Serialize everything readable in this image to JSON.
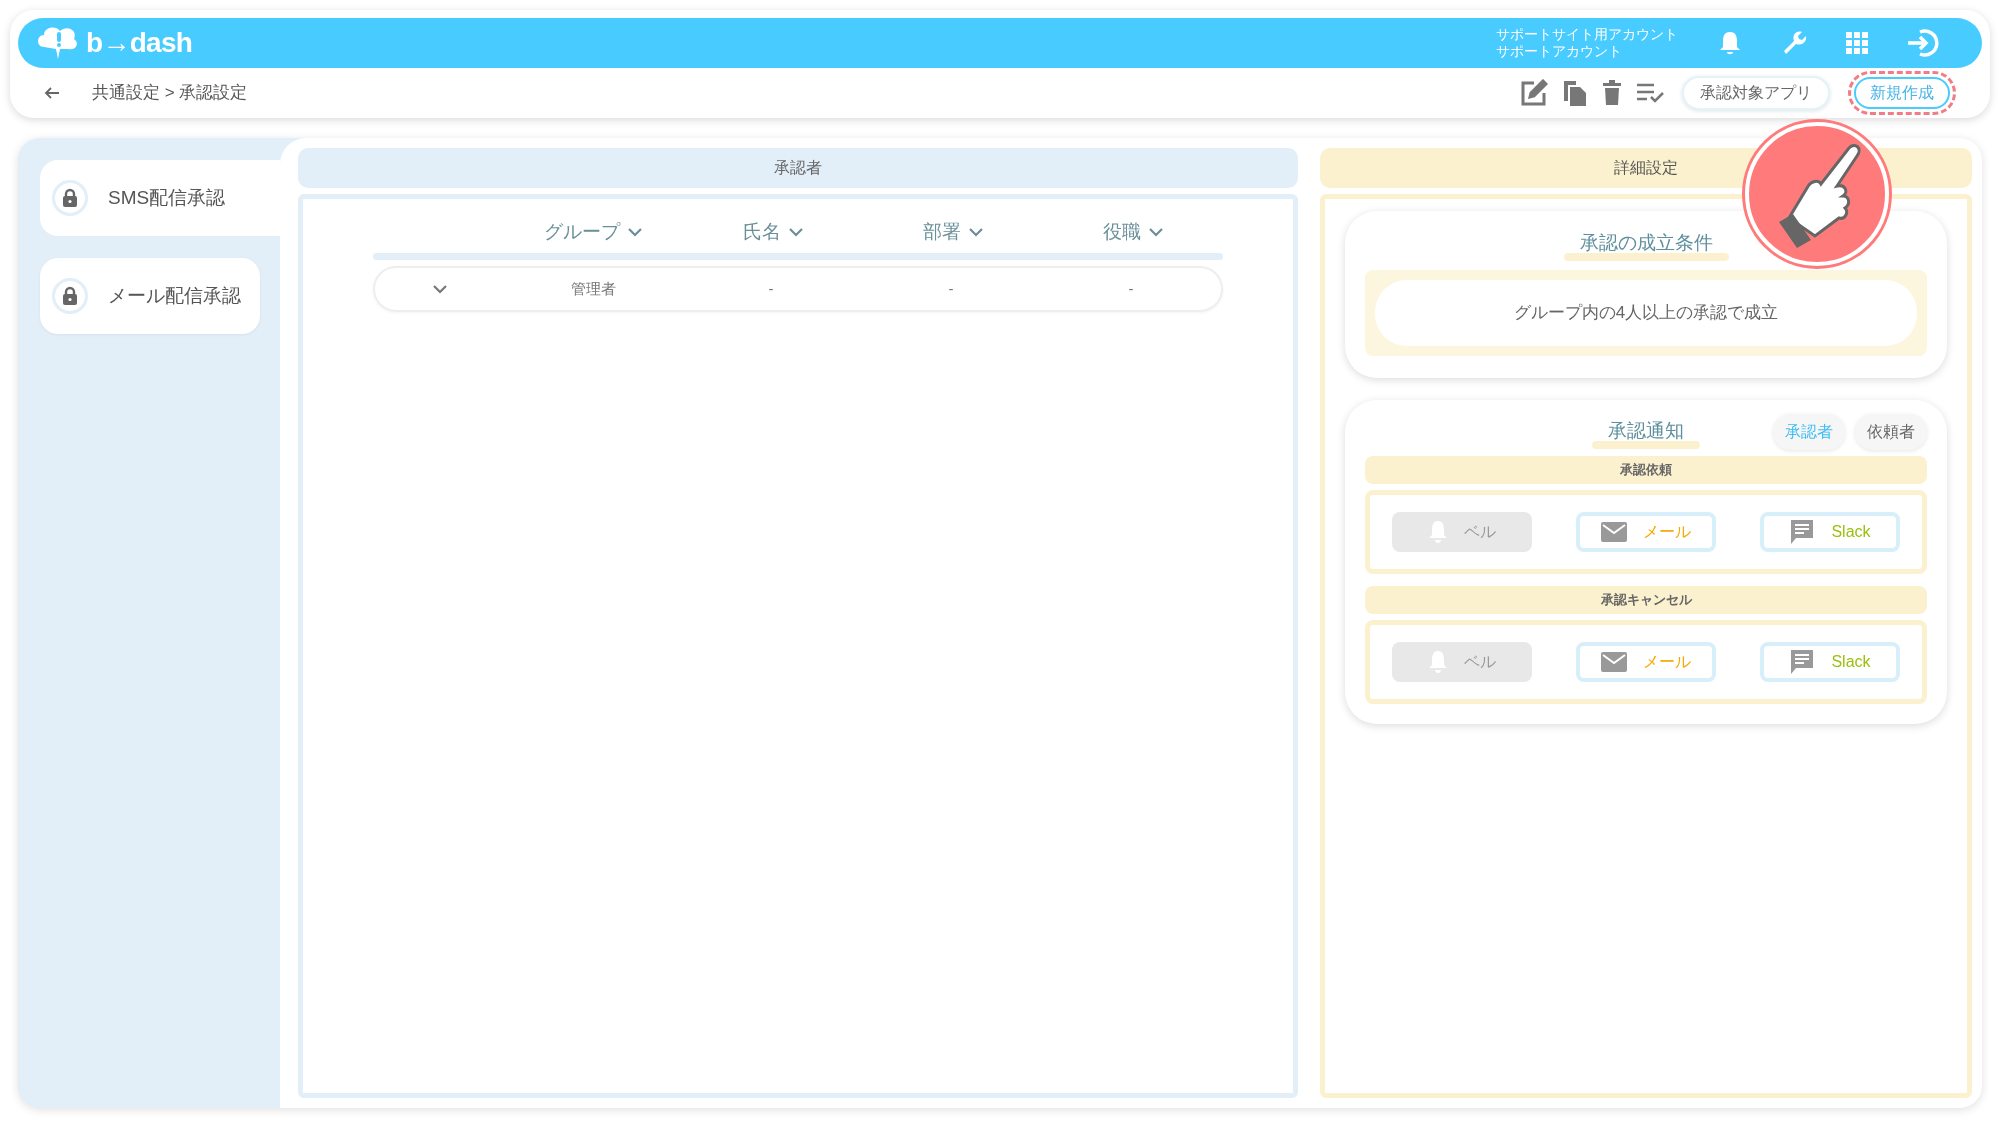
{
  "header": {
    "logo": "b→dash",
    "account_lines": [
      "サポートサイト用アカウント",
      "サポートアカウント"
    ]
  },
  "breadcrumb": "共通設定 > 承認設定",
  "toolbar": {
    "apps_button": "承認対象アプリ",
    "new_button": "新規作成"
  },
  "sidebar": {
    "items": [
      {
        "label": "SMS配信承認",
        "selected": true
      },
      {
        "label": "メール配信承認",
        "selected": false
      }
    ]
  },
  "approvers": {
    "title": "承認者",
    "columns": [
      "グループ",
      "氏名",
      "部署",
      "役職"
    ],
    "rows": [
      {
        "expanded": false,
        "cells": [
          "管理者",
          "-",
          "-",
          "-"
        ]
      }
    ]
  },
  "details": {
    "title": "詳細設定",
    "condition": {
      "title": "承認の成立条件",
      "text": "グループ内の4人以上の承認で成立"
    },
    "notification": {
      "title": "承認通知",
      "toggles": [
        {
          "label": "承認者",
          "selected": true
        },
        {
          "label": "依頼者",
          "selected": false
        }
      ],
      "sections": [
        {
          "title": "承認依頼",
          "channels": [
            {
              "kind": "bell",
              "label": "ベル",
              "enabled": false
            },
            {
              "kind": "mail",
              "label": "メール",
              "enabled": true,
              "color": "#f5a800"
            },
            {
              "kind": "chat",
              "label": "Slack",
              "enabled": true,
              "color": "#9bbf0f"
            }
          ]
        },
        {
          "title": "承認キャンセル",
          "channels": [
            {
              "kind": "bell",
              "label": "ベル",
              "enabled": false
            },
            {
              "kind": "mail",
              "label": "メール",
              "enabled": true,
              "color": "#f5a800"
            },
            {
              "kind": "chat",
              "label": "Slack",
              "enabled": true,
              "color": "#9bbf0f"
            }
          ]
        }
      ]
    }
  }
}
